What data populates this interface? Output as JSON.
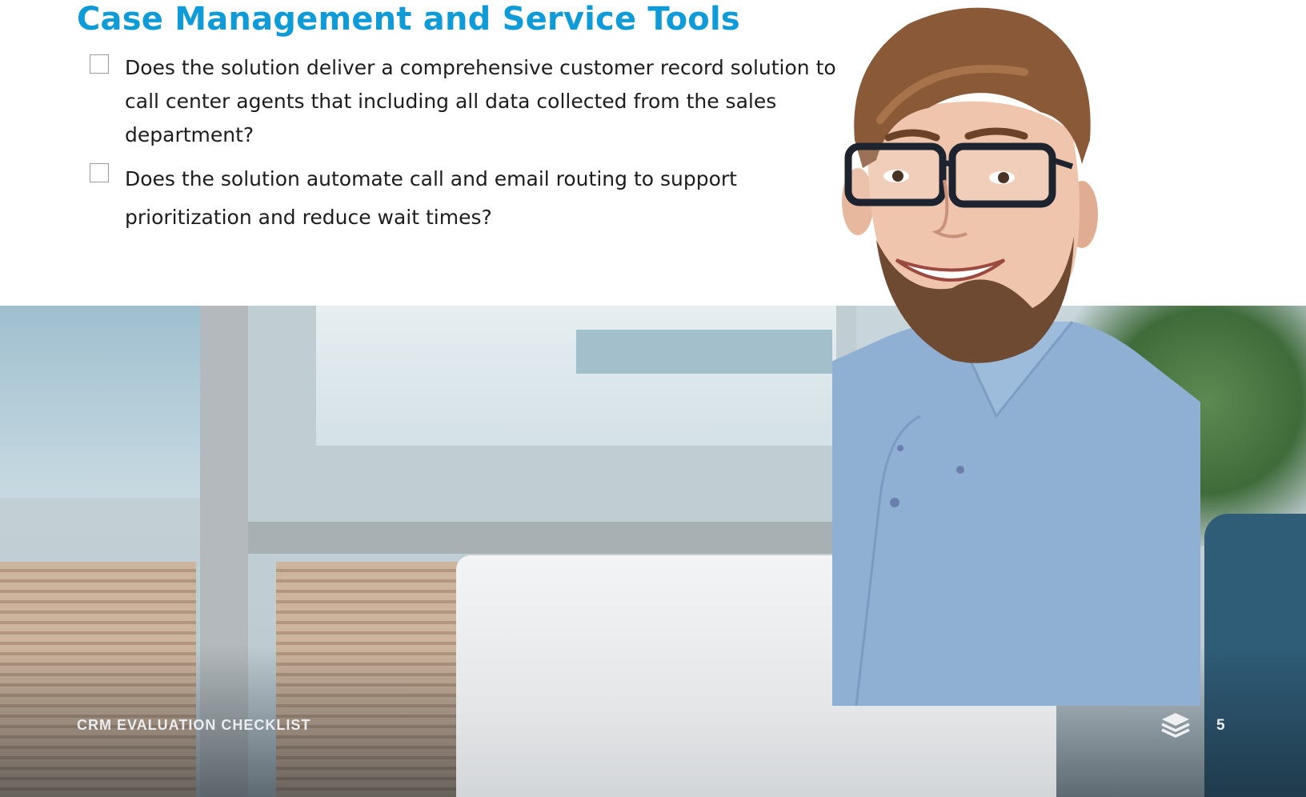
{
  "heading": "Case Management and Service Tools",
  "checklist": [
    {
      "question": "Does the solution deliver a comprehensive customer record solution to call center agents that including all data collected from the sales department?",
      "checked": false
    },
    {
      "question": "Does the solution automate call and email routing to support prioritization and reduce wait times?",
      "checked": false
    }
  ],
  "footer": {
    "doc_title": "CRM EVALUATION CHECKLIST",
    "page_number": "5",
    "logo_icon": "stacked-layers-icon"
  },
  "colors": {
    "heading": "#0f9ad8",
    "body_text": "#1d1d1f",
    "footer_text": "#e9edf0"
  }
}
